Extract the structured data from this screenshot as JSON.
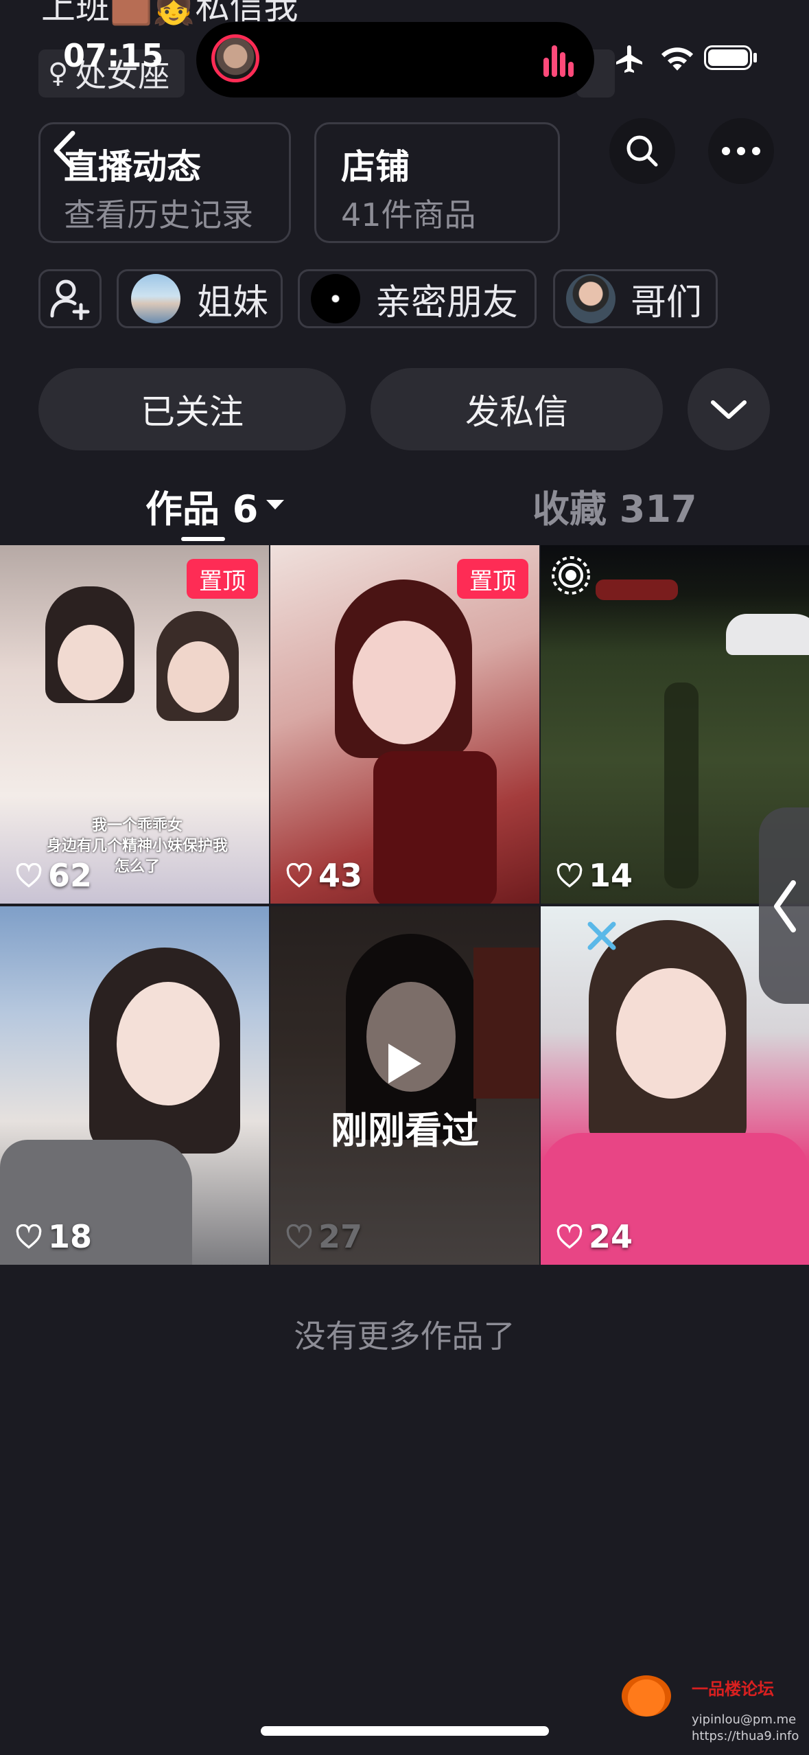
{
  "status_bar": {
    "time": "07:15",
    "top_partial_text": "上班🟫👧私信我",
    "location_chip": "处女座"
  },
  "header": {
    "live_card": {
      "title": "直播动态",
      "subtitle": "查看历史记录"
    },
    "shop_card": {
      "title": "店铺",
      "subtitle": "41件商品"
    }
  },
  "groups": [
    {
      "label": "姐妹"
    },
    {
      "label": "亲密朋友"
    },
    {
      "label": "哥们"
    }
  ],
  "actions": {
    "follow_label": "已关注",
    "message_label": "发私信"
  },
  "tabs": {
    "works_label": "作品 6",
    "favorites_label": "收藏 317"
  },
  "videos": [
    {
      "likes": "62",
      "pinned": "置顶",
      "caption": "我一个乖乖女\n身边有几个精神小妹保护我\n怎么了"
    },
    {
      "likes": "43",
      "pinned": "置顶"
    },
    {
      "likes": "14"
    },
    {
      "likes": "18"
    },
    {
      "likes": "27",
      "overlay": "刚刚看过"
    },
    {
      "likes": "24"
    }
  ],
  "footer": {
    "no_more": "没有更多作品了"
  },
  "watermark": {
    "title": "一品楼论坛",
    "line1": "yipinlou@pm.me",
    "line2": "https://thua9.info"
  },
  "colors": {
    "background": "#1b1b22",
    "accent": "#fe2c55",
    "button": "#2c2c33"
  }
}
